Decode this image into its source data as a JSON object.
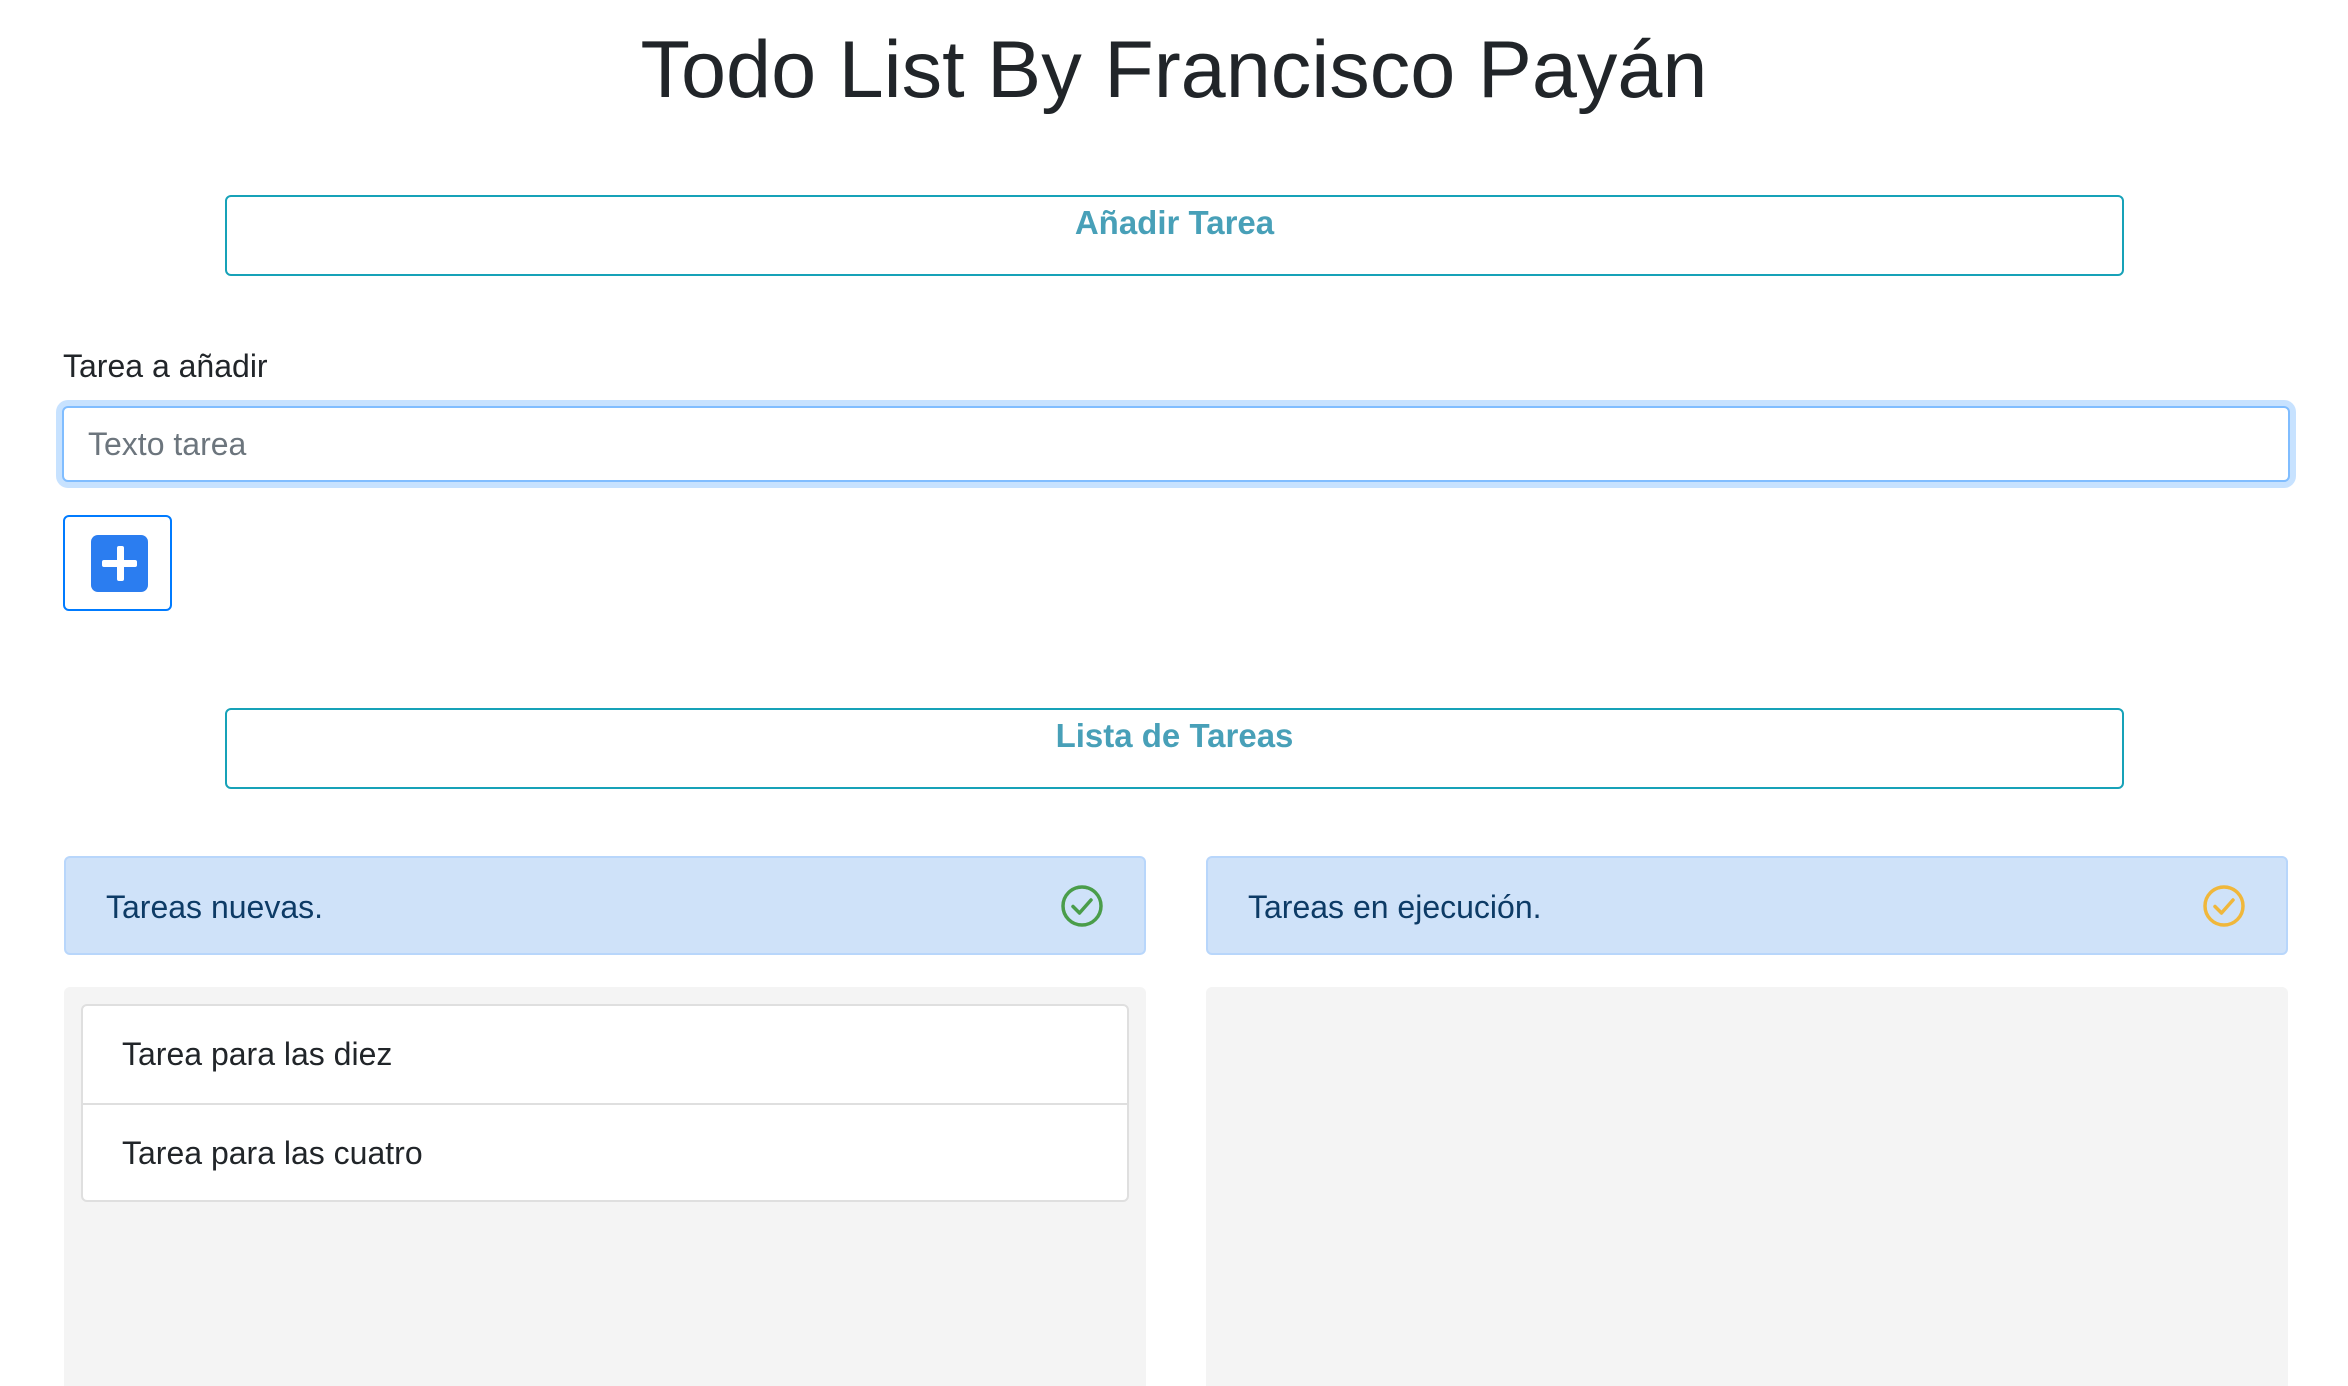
{
  "page": {
    "title": "Todo List By Francisco Payán"
  },
  "add_section": {
    "title": "Añadir Tarea",
    "field_label": "Tarea a añadir",
    "input_value": "",
    "input_placeholder": "Texto tarea",
    "add_button_icon": "plus-square-icon"
  },
  "list_section": {
    "title": "Lista de Tareas"
  },
  "columns": [
    {
      "title": "Tareas nuevas.",
      "icon": "check-circle-icon",
      "icon_color": "#4a9d4a",
      "tasks": [
        "Tarea para las diez",
        "Tarea para las cuatro"
      ]
    },
    {
      "title": "Tareas en ejecución.",
      "icon": "check-circle-icon",
      "icon_color": "#f0b73b",
      "tasks": []
    }
  ],
  "colors": {
    "section_title": "#48a0b8",
    "section_border": "#17a2b8",
    "header_bg": "#cfe2f9",
    "header_text": "#0d3b66",
    "add_button_border": "#007bff",
    "plus_icon": "#2b7df0"
  }
}
